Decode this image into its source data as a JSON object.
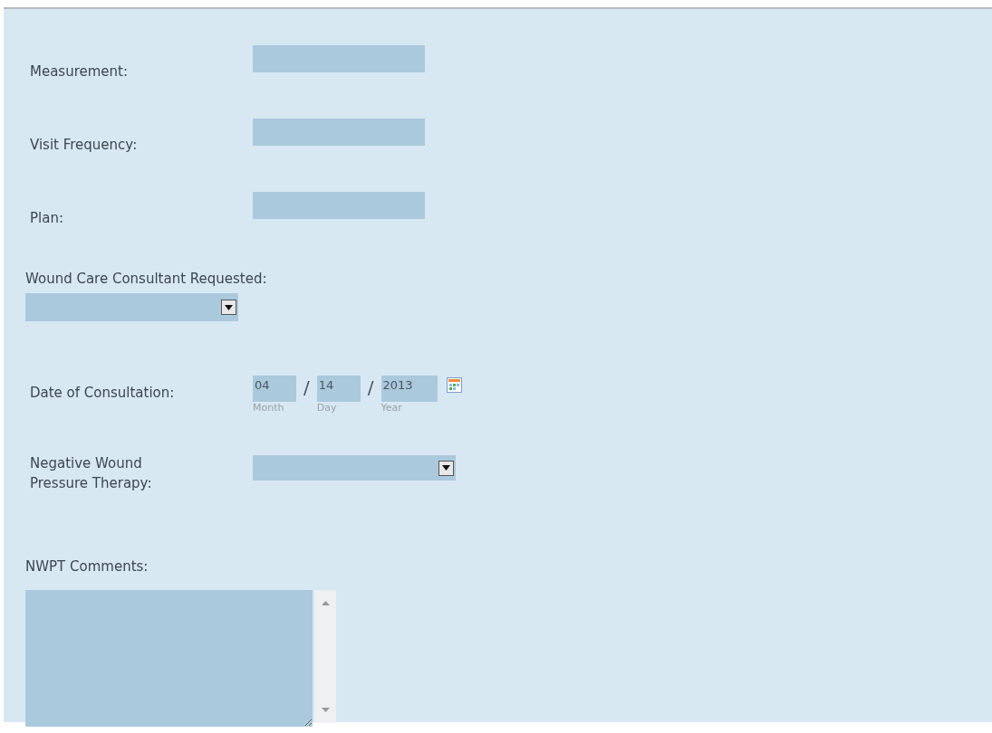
{
  "fields": [
    {
      "kind": "text",
      "label": "Measurement:"
    },
    {
      "kind": "text",
      "label": "Visit Frequency:"
    },
    {
      "kind": "text",
      "label": "Plan:"
    },
    {
      "kind": "select_below",
      "label": "Wound Care Consultant Requested:"
    },
    {
      "kind": "date",
      "label": "Date of Consultation:",
      "parts": [
        {
          "value": "04",
          "caption": "Month"
        },
        {
          "value": "14",
          "caption": "Day"
        },
        {
          "value": "2013",
          "caption": "Year"
        }
      ],
      "separator": "/"
    },
    {
      "kind": "select",
      "label": "Negative Wound Pressure Therapy:"
    },
    {
      "kind": "textarea",
      "label": "NWPT Comments:"
    }
  ]
}
